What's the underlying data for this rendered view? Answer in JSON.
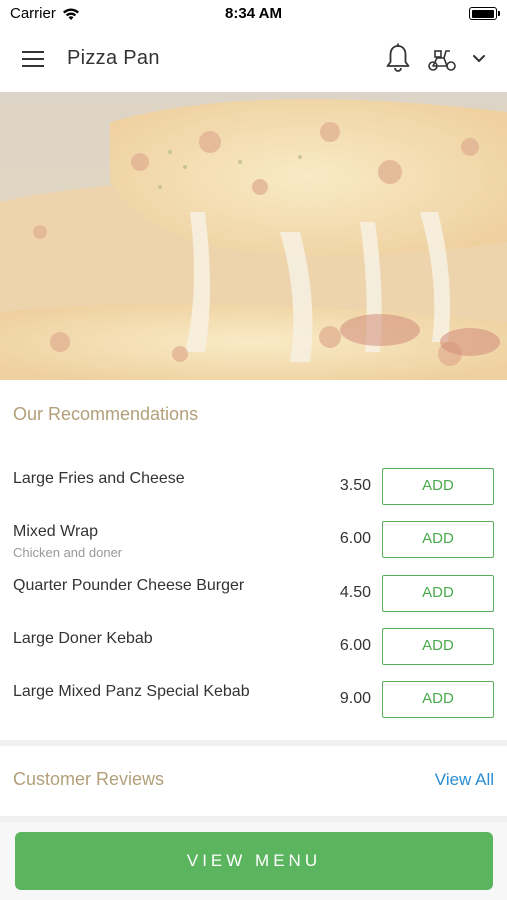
{
  "status_bar": {
    "carrier": "Carrier",
    "time": "8:34 AM"
  },
  "header": {
    "title": "Pizza Pan",
    "icons": [
      "menu-icon",
      "bell-icon",
      "scooter-icon",
      "chevron-down-icon"
    ]
  },
  "recommendations": {
    "title": "Our Recommendations",
    "add_label": "ADD",
    "items": [
      {
        "name": "Large Fries and Cheese",
        "subtitle": "",
        "price": "3.50"
      },
      {
        "name": "Mixed Wrap",
        "subtitle": "Chicken and doner",
        "price": "6.00"
      },
      {
        "name": "Quarter Pounder Cheese Burger",
        "subtitle": "",
        "price": "4.50"
      },
      {
        "name": "Large Doner Kebab",
        "subtitle": "",
        "price": "6.00"
      },
      {
        "name": "Large Mixed Panz Special Kebab",
        "subtitle": "",
        "price": "9.00"
      }
    ]
  },
  "reviews": {
    "title": "Customer Reviews",
    "view_all": "View All"
  },
  "footer": {
    "view_menu": "VIEW MENU"
  },
  "colors": {
    "accent_green": "#5ab55e",
    "section_title": "#b3a07a",
    "link_blue": "#2a8ed0"
  }
}
